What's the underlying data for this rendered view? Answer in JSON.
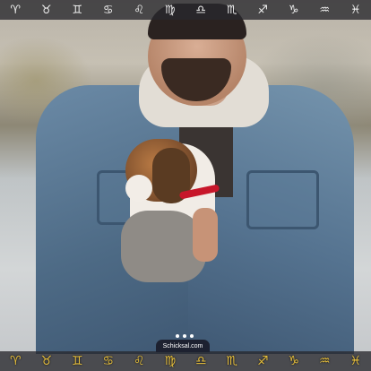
{
  "top_bar": {
    "signs": [
      {
        "symbol": "♈",
        "icon": "aries-icon"
      },
      {
        "symbol": "♉",
        "icon": "taurus-icon"
      },
      {
        "symbol": "♊",
        "icon": "gemini-icon"
      },
      {
        "symbol": "♋",
        "icon": "cancer-icon"
      },
      {
        "symbol": "♌",
        "icon": "leo-icon"
      },
      {
        "symbol": "♍",
        "icon": "virgo-icon"
      },
      {
        "symbol": "♎",
        "icon": "libra-icon"
      },
      {
        "symbol": "♏",
        "icon": "scorpio-icon"
      },
      {
        "symbol": "♐",
        "icon": "sagittarius-icon"
      },
      {
        "symbol": "♑",
        "icon": "capricorn-icon"
      },
      {
        "symbol": "♒",
        "icon": "aquarius-icon"
      },
      {
        "symbol": "♓",
        "icon": "pisces-icon"
      }
    ]
  },
  "bottom_bar": {
    "signs": [
      {
        "symbol": "♈",
        "icon": "aries-gold-icon"
      },
      {
        "symbol": "♉",
        "icon": "taurus-gold-icon"
      },
      {
        "symbol": "♊",
        "icon": "gemini-gold-icon"
      },
      {
        "symbol": "♋",
        "icon": "cancer-gold-icon"
      },
      {
        "symbol": "♌",
        "icon": "leo-gold-icon"
      },
      {
        "symbol": "♍",
        "icon": "virgo-gold-icon"
      },
      {
        "symbol": "♎",
        "icon": "libra-gold-icon"
      },
      {
        "symbol": "♏",
        "icon": "scorpio-gold-icon"
      },
      {
        "symbol": "♐",
        "icon": "sagittarius-gold-icon"
      },
      {
        "symbol": "♑",
        "icon": "capricorn-gold-icon"
      },
      {
        "symbol": "♒",
        "icon": "aquarius-gold-icon"
      },
      {
        "symbol": "♓",
        "icon": "pisces-gold-icon"
      }
    ]
  },
  "brand": {
    "label": "Schicksal.com"
  },
  "colors": {
    "bar_background": "#28282d",
    "gold": "#e8c03c",
    "collar_red": "#c7162a"
  }
}
